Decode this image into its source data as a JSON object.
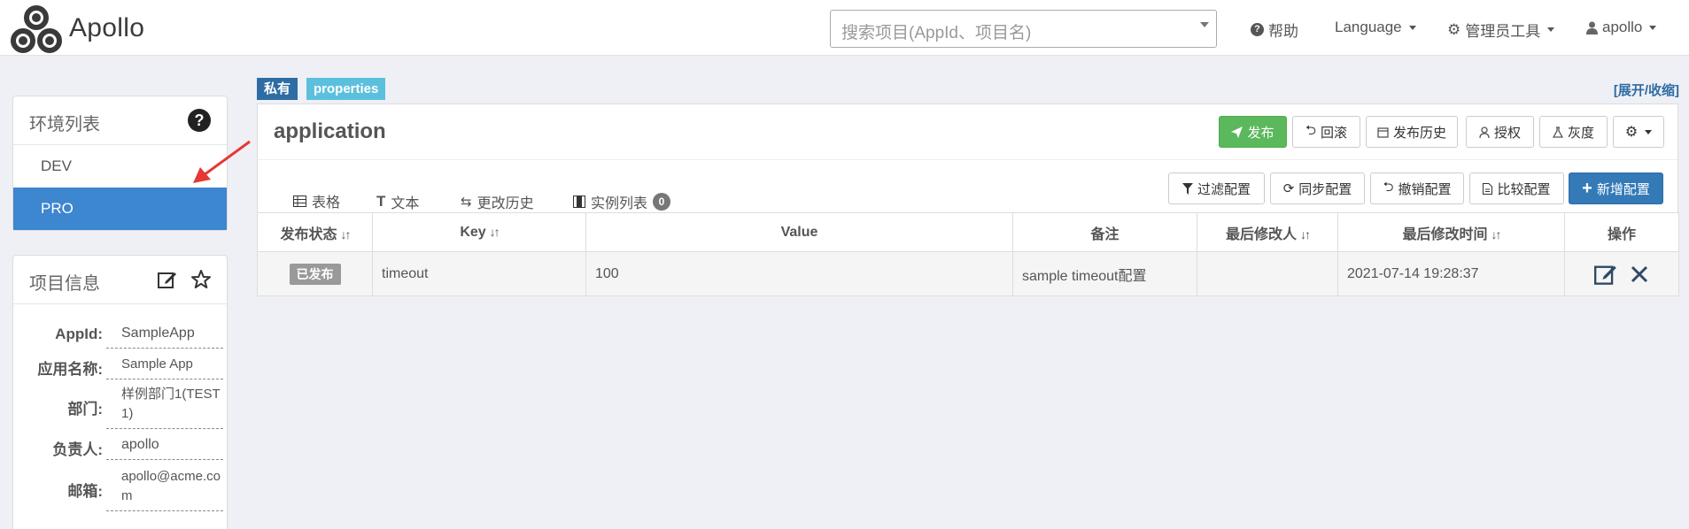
{
  "brand": {
    "name": "Apollo"
  },
  "search": {
    "placeholder": "搜索项目(AppId、项目名)"
  },
  "nav": {
    "help": "帮助",
    "language": "Language",
    "admin_tools": "管理员工具",
    "user": "apollo"
  },
  "env_panel": {
    "title": "环境列表",
    "items": [
      {
        "label": "DEV",
        "active": false
      },
      {
        "label": "PRO",
        "active": true
      }
    ]
  },
  "project_info": {
    "title": "项目信息",
    "fields": [
      {
        "label": "AppId:",
        "value": "SampleApp"
      },
      {
        "label": "应用名称:",
        "value": "Sample App"
      },
      {
        "label": "部门:",
        "value": "样例部门1(TEST1)"
      },
      {
        "label": "负责人:",
        "value": "apollo"
      },
      {
        "label": "邮箱:",
        "value": "apollo@acme.com"
      }
    ]
  },
  "namespace": {
    "tags": {
      "private": "私有",
      "format": "properties"
    },
    "expand_link": "[展开/收缩]",
    "name": "application",
    "actions": {
      "publish": "发布",
      "rollback": "回滚",
      "history": "发布历史",
      "authorize": "授权",
      "gray": "灰度"
    },
    "tabs": [
      {
        "label": "表格",
        "active": true
      },
      {
        "label": "文本",
        "active": false
      },
      {
        "label": "更改历史",
        "active": false
      },
      {
        "label": "实例列表",
        "active": false,
        "badge": "0"
      }
    ],
    "toolbar": {
      "filter": "过滤配置",
      "sync": "同步配置",
      "revoke": "撤销配置",
      "compare": "比较配置",
      "add": "新增配置"
    },
    "table": {
      "headers": {
        "status": "发布状态",
        "key": "Key",
        "value": "Value",
        "comment": "备注",
        "modifier": "最后修改人",
        "modified_time": "最后修改时间",
        "ops": "操作"
      },
      "rows": [
        {
          "status": "已发布",
          "key": "timeout",
          "value": "100",
          "comment": "sample timeout配置",
          "modifier": "",
          "modified_time": "2021-07-14 19:28:37"
        }
      ]
    }
  },
  "colors": {
    "primary": "#337ab7",
    "active_env": "#3d86d0",
    "publish_green": "#5cb85c",
    "tag_blue": "#2e6da4",
    "tag_cyan": "#5bc0de",
    "arrow_red": "#e53935"
  }
}
